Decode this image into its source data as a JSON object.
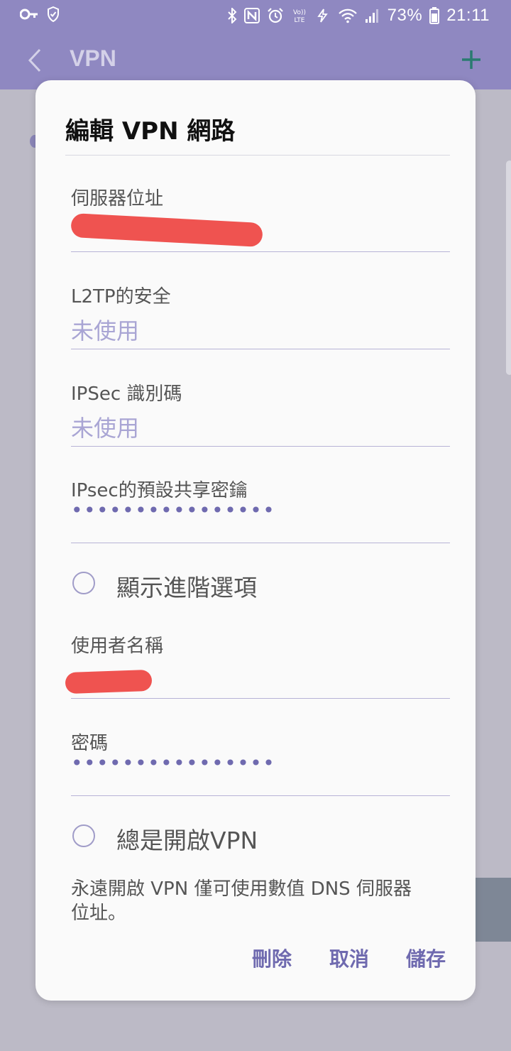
{
  "status_bar": {
    "battery": "73%",
    "time": "21:11",
    "icons": [
      "key-icon",
      "shield-icon",
      "bluetooth-icon",
      "nfc-icon",
      "alarm-icon",
      "volte-icon",
      "data-saver-icon",
      "wifi-icon",
      "signal-icon",
      "battery-icon"
    ]
  },
  "app_bar": {
    "title": "VPN",
    "back_icon": "chevron-left-icon",
    "add_icon": "plus-icon"
  },
  "dialog": {
    "title": "編輯 VPN 網路",
    "fields": [
      {
        "label": "伺服器位址",
        "value": "",
        "redacted": true
      },
      {
        "label": "L2TP的安全",
        "value": "未使用"
      },
      {
        "label": "IPSec 識別碼",
        "value": "未使用"
      },
      {
        "label": "IPsec的預設共享密鑰",
        "value": "••••••••••••••••"
      },
      {
        "label": "使用者名稱",
        "value": "",
        "redacted": true
      },
      {
        "label": "密碼",
        "value": "••••••••••••••••"
      }
    ],
    "show_advanced": {
      "label": "顯示進階選項",
      "checked": false
    },
    "always_on": {
      "label": "總是開啟VPN",
      "checked": false
    },
    "note": "永遠開啟 VPN 僅可使用數值 DNS 伺服器位址。",
    "buttons": {
      "delete": "刪除",
      "cancel": "取消",
      "save": "儲存"
    }
  },
  "colors": {
    "accent": "#6f6aaf",
    "status_bar": "#8f88c1",
    "redaction": "#ef5350",
    "scrim": "#bcbac6"
  }
}
